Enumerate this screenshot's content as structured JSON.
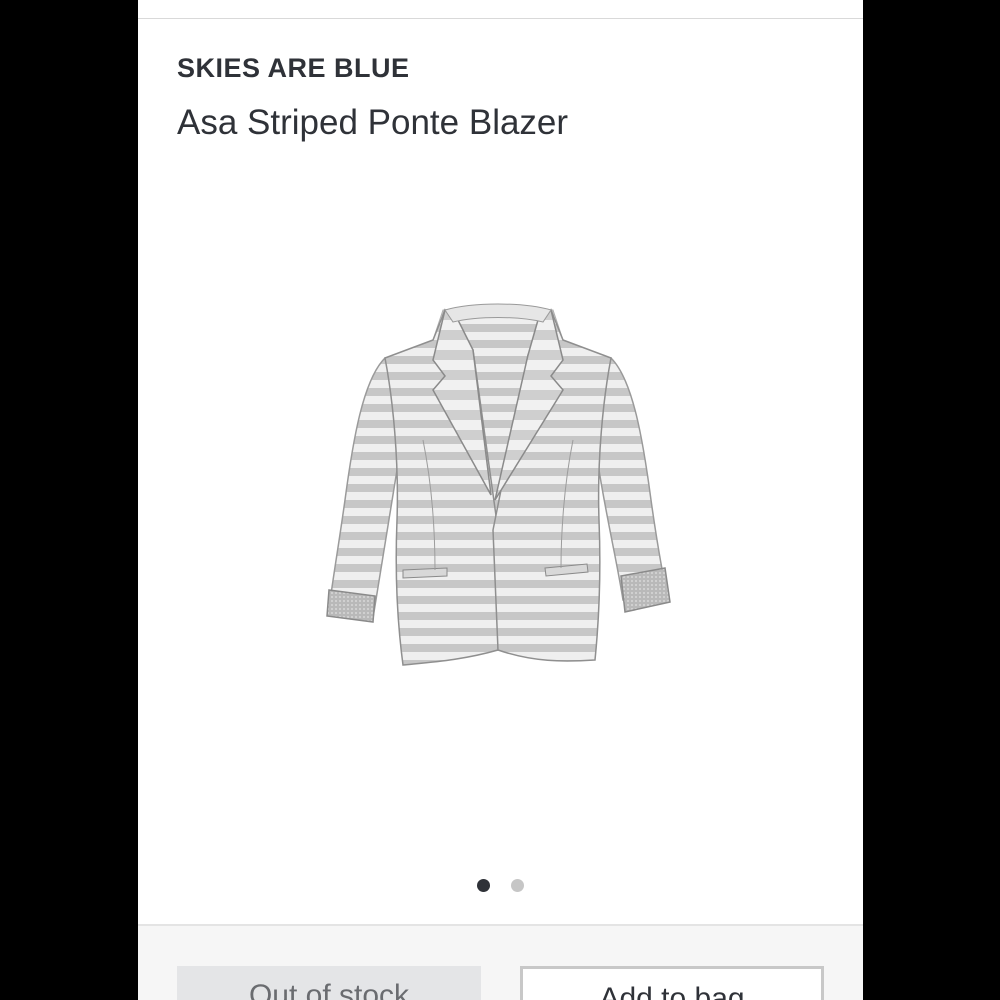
{
  "product": {
    "brand": "SKIES ARE BLUE",
    "name": "Asa Striped Ponte Blazer",
    "image_alt": "Asa Striped Ponte Blazer product photo",
    "image_icon": "striped-blazer-image"
  },
  "carousel": {
    "total": 2,
    "active_index": 1
  },
  "actions": {
    "out_of_stock_label": "Out of stock",
    "add_label": "Add to bag"
  },
  "colors": {
    "text": "#2f3238",
    "dot_active": "#2f3238",
    "dot_inactive": "#c6c6c6",
    "stripe_light": "#eeeeee",
    "stripe_dark": "#c9c9c9"
  }
}
